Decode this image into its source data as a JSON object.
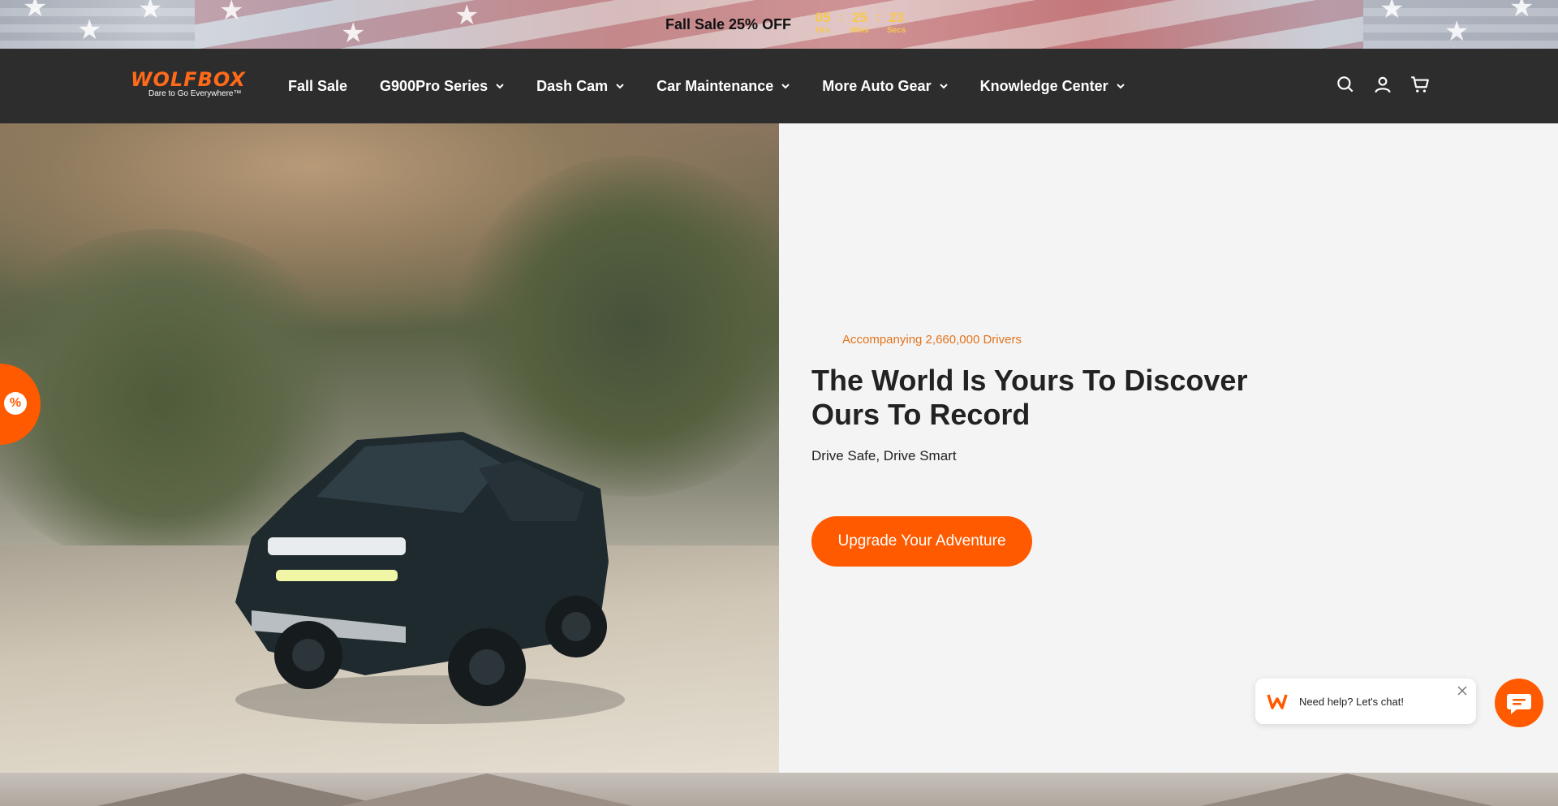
{
  "announcement": {
    "text": "Fall Sale 25% OFF",
    "countdown": {
      "hours": "05",
      "hours_label": "Hrs",
      "minutes": "25",
      "minutes_label": "Mins",
      "seconds": "23",
      "seconds_label": "Secs",
      "separator": ":"
    }
  },
  "header": {
    "logo": {
      "wordmark": "WOLFBOX",
      "tagline": "Dare to Go Everywhere™"
    },
    "nav": [
      {
        "label": "Fall Sale",
        "has_dropdown": false
      },
      {
        "label": "G900Pro Series",
        "has_dropdown": true
      },
      {
        "label": "Dash Cam",
        "has_dropdown": true
      },
      {
        "label": "Car Maintenance",
        "has_dropdown": true
      },
      {
        "label": "More Auto Gear",
        "has_dropdown": true
      },
      {
        "label": "Knowledge Center",
        "has_dropdown": true
      }
    ],
    "icons": [
      "search-icon",
      "account-icon",
      "cart-icon"
    ]
  },
  "hero": {
    "eyebrow": "Accompanying 2,660,000 Drivers",
    "title_line1": "The World Is Yours To Discover",
    "title_line2": "Ours To Record",
    "subtitle": "Drive Safe, Drive Smart",
    "cta_label": "Upgrade Your Adventure"
  },
  "discount_tab": {
    "symbol": "%"
  },
  "chat": {
    "prompt": "Need help? Let's chat!"
  },
  "colors": {
    "accent": "#ff5a00",
    "header_bg": "#2d2d2d",
    "eyebrow": "#e2731d",
    "countdown": "#f7c84a"
  }
}
